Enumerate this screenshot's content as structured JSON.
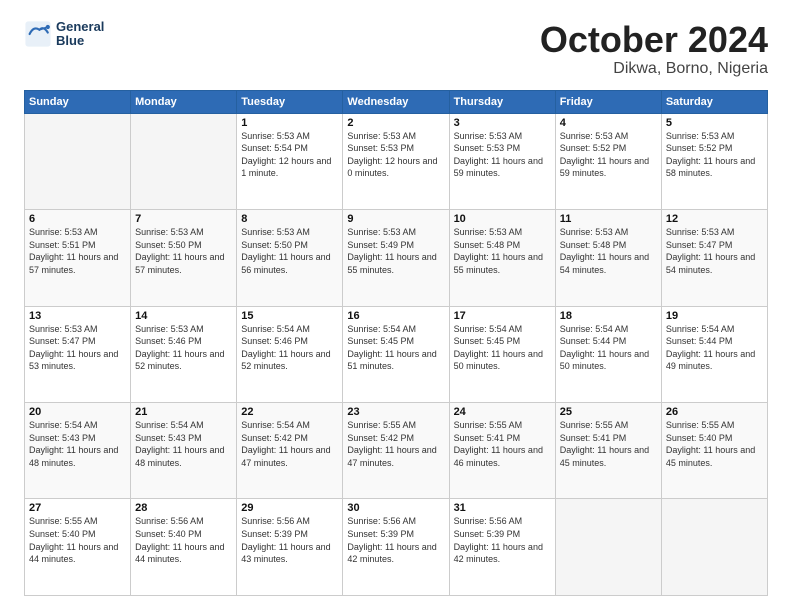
{
  "header": {
    "logo_line1": "General",
    "logo_line2": "Blue",
    "title": "October 2024",
    "subtitle": "Dikwa, Borno, Nigeria"
  },
  "calendar": {
    "columns": [
      "Sunday",
      "Monday",
      "Tuesday",
      "Wednesday",
      "Thursday",
      "Friday",
      "Saturday"
    ],
    "rows": [
      [
        {
          "day": "",
          "sunrise": "",
          "sunset": "",
          "daylight": "",
          "empty": true
        },
        {
          "day": "",
          "sunrise": "",
          "sunset": "",
          "daylight": "",
          "empty": true
        },
        {
          "day": "1",
          "sunrise": "Sunrise: 5:53 AM",
          "sunset": "Sunset: 5:54 PM",
          "daylight": "Daylight: 12 hours and 1 minute.",
          "empty": false
        },
        {
          "day": "2",
          "sunrise": "Sunrise: 5:53 AM",
          "sunset": "Sunset: 5:53 PM",
          "daylight": "Daylight: 12 hours and 0 minutes.",
          "empty": false
        },
        {
          "day": "3",
          "sunrise": "Sunrise: 5:53 AM",
          "sunset": "Sunset: 5:53 PM",
          "daylight": "Daylight: 11 hours and 59 minutes.",
          "empty": false
        },
        {
          "day": "4",
          "sunrise": "Sunrise: 5:53 AM",
          "sunset": "Sunset: 5:52 PM",
          "daylight": "Daylight: 11 hours and 59 minutes.",
          "empty": false
        },
        {
          "day": "5",
          "sunrise": "Sunrise: 5:53 AM",
          "sunset": "Sunset: 5:52 PM",
          "daylight": "Daylight: 11 hours and 58 minutes.",
          "empty": false
        }
      ],
      [
        {
          "day": "6",
          "sunrise": "Sunrise: 5:53 AM",
          "sunset": "Sunset: 5:51 PM",
          "daylight": "Daylight: 11 hours and 57 minutes.",
          "empty": false
        },
        {
          "day": "7",
          "sunrise": "Sunrise: 5:53 AM",
          "sunset": "Sunset: 5:50 PM",
          "daylight": "Daylight: 11 hours and 57 minutes.",
          "empty": false
        },
        {
          "day": "8",
          "sunrise": "Sunrise: 5:53 AM",
          "sunset": "Sunset: 5:50 PM",
          "daylight": "Daylight: 11 hours and 56 minutes.",
          "empty": false
        },
        {
          "day": "9",
          "sunrise": "Sunrise: 5:53 AM",
          "sunset": "Sunset: 5:49 PM",
          "daylight": "Daylight: 11 hours and 55 minutes.",
          "empty": false
        },
        {
          "day": "10",
          "sunrise": "Sunrise: 5:53 AM",
          "sunset": "Sunset: 5:48 PM",
          "daylight": "Daylight: 11 hours and 55 minutes.",
          "empty": false
        },
        {
          "day": "11",
          "sunrise": "Sunrise: 5:53 AM",
          "sunset": "Sunset: 5:48 PM",
          "daylight": "Daylight: 11 hours and 54 minutes.",
          "empty": false
        },
        {
          "day": "12",
          "sunrise": "Sunrise: 5:53 AM",
          "sunset": "Sunset: 5:47 PM",
          "daylight": "Daylight: 11 hours and 54 minutes.",
          "empty": false
        }
      ],
      [
        {
          "day": "13",
          "sunrise": "Sunrise: 5:53 AM",
          "sunset": "Sunset: 5:47 PM",
          "daylight": "Daylight: 11 hours and 53 minutes.",
          "empty": false
        },
        {
          "day": "14",
          "sunrise": "Sunrise: 5:53 AM",
          "sunset": "Sunset: 5:46 PM",
          "daylight": "Daylight: 11 hours and 52 minutes.",
          "empty": false
        },
        {
          "day": "15",
          "sunrise": "Sunrise: 5:54 AM",
          "sunset": "Sunset: 5:46 PM",
          "daylight": "Daylight: 11 hours and 52 minutes.",
          "empty": false
        },
        {
          "day": "16",
          "sunrise": "Sunrise: 5:54 AM",
          "sunset": "Sunset: 5:45 PM",
          "daylight": "Daylight: 11 hours and 51 minutes.",
          "empty": false
        },
        {
          "day": "17",
          "sunrise": "Sunrise: 5:54 AM",
          "sunset": "Sunset: 5:45 PM",
          "daylight": "Daylight: 11 hours and 50 minutes.",
          "empty": false
        },
        {
          "day": "18",
          "sunrise": "Sunrise: 5:54 AM",
          "sunset": "Sunset: 5:44 PM",
          "daylight": "Daylight: 11 hours and 50 minutes.",
          "empty": false
        },
        {
          "day": "19",
          "sunrise": "Sunrise: 5:54 AM",
          "sunset": "Sunset: 5:44 PM",
          "daylight": "Daylight: 11 hours and 49 minutes.",
          "empty": false
        }
      ],
      [
        {
          "day": "20",
          "sunrise": "Sunrise: 5:54 AM",
          "sunset": "Sunset: 5:43 PM",
          "daylight": "Daylight: 11 hours and 48 minutes.",
          "empty": false
        },
        {
          "day": "21",
          "sunrise": "Sunrise: 5:54 AM",
          "sunset": "Sunset: 5:43 PM",
          "daylight": "Daylight: 11 hours and 48 minutes.",
          "empty": false
        },
        {
          "day": "22",
          "sunrise": "Sunrise: 5:54 AM",
          "sunset": "Sunset: 5:42 PM",
          "daylight": "Daylight: 11 hours and 47 minutes.",
          "empty": false
        },
        {
          "day": "23",
          "sunrise": "Sunrise: 5:55 AM",
          "sunset": "Sunset: 5:42 PM",
          "daylight": "Daylight: 11 hours and 47 minutes.",
          "empty": false
        },
        {
          "day": "24",
          "sunrise": "Sunrise: 5:55 AM",
          "sunset": "Sunset: 5:41 PM",
          "daylight": "Daylight: 11 hours and 46 minutes.",
          "empty": false
        },
        {
          "day": "25",
          "sunrise": "Sunrise: 5:55 AM",
          "sunset": "Sunset: 5:41 PM",
          "daylight": "Daylight: 11 hours and 45 minutes.",
          "empty": false
        },
        {
          "day": "26",
          "sunrise": "Sunrise: 5:55 AM",
          "sunset": "Sunset: 5:40 PM",
          "daylight": "Daylight: 11 hours and 45 minutes.",
          "empty": false
        }
      ],
      [
        {
          "day": "27",
          "sunrise": "Sunrise: 5:55 AM",
          "sunset": "Sunset: 5:40 PM",
          "daylight": "Daylight: 11 hours and 44 minutes.",
          "empty": false
        },
        {
          "day": "28",
          "sunrise": "Sunrise: 5:56 AM",
          "sunset": "Sunset: 5:40 PM",
          "daylight": "Daylight: 11 hours and 44 minutes.",
          "empty": false
        },
        {
          "day": "29",
          "sunrise": "Sunrise: 5:56 AM",
          "sunset": "Sunset: 5:39 PM",
          "daylight": "Daylight: 11 hours and 43 minutes.",
          "empty": false
        },
        {
          "day": "30",
          "sunrise": "Sunrise: 5:56 AM",
          "sunset": "Sunset: 5:39 PM",
          "daylight": "Daylight: 11 hours and 42 minutes.",
          "empty": false
        },
        {
          "day": "31",
          "sunrise": "Sunrise: 5:56 AM",
          "sunset": "Sunset: 5:39 PM",
          "daylight": "Daylight: 11 hours and 42 minutes.",
          "empty": false
        },
        {
          "day": "",
          "sunrise": "",
          "sunset": "",
          "daylight": "",
          "empty": true
        },
        {
          "day": "",
          "sunrise": "",
          "sunset": "",
          "daylight": "",
          "empty": true
        }
      ]
    ]
  }
}
